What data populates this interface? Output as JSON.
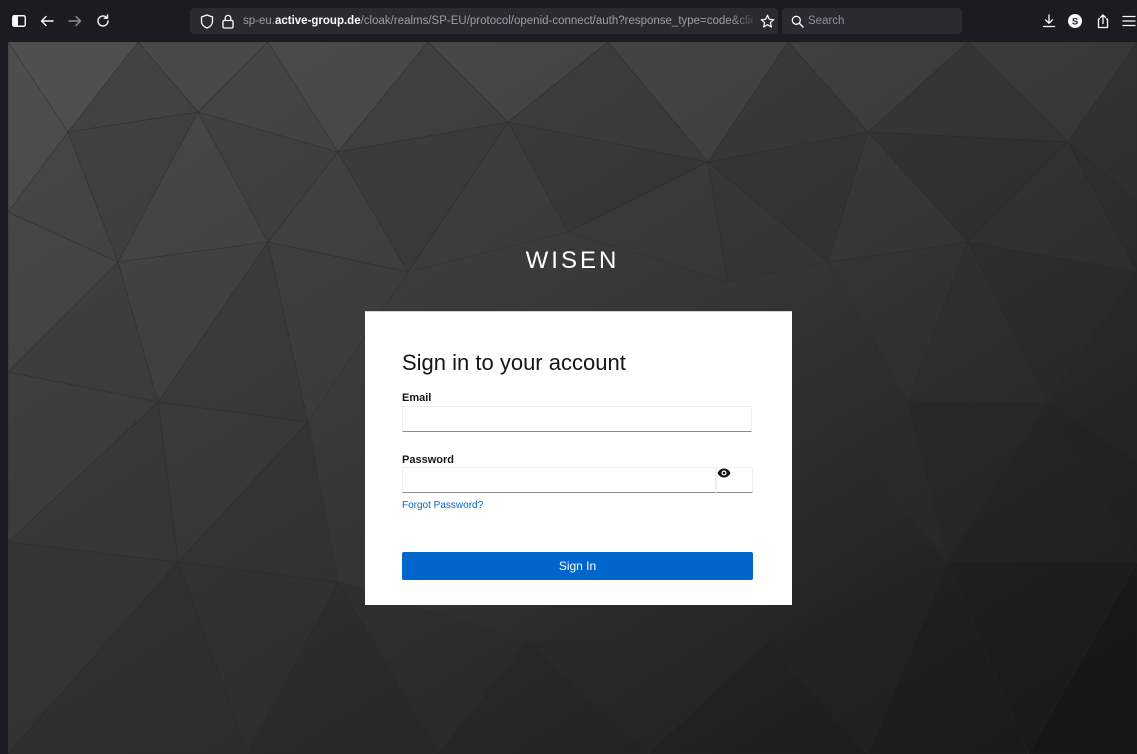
{
  "browser": {
    "url_protocol": "sp-eu.",
    "url_domain": "active-group.de",
    "url_path": "/cloak/realms/SP-EU/protocol/openid-connect/auth?response_type=code&client_id=wisen",
    "search_placeholder": "Search",
    "profile_initial": "S"
  },
  "login": {
    "brand": "WISEN",
    "title": "Sign in to your account",
    "email_label": "Email",
    "email_value": "",
    "password_label": "Password",
    "password_value": "",
    "forgot_label": "Forgot Password?",
    "submit_label": "Sign In"
  },
  "colors": {
    "primary": "#0066cc",
    "toolbar": "#1c1b22",
    "background": "#3a3a3a"
  }
}
